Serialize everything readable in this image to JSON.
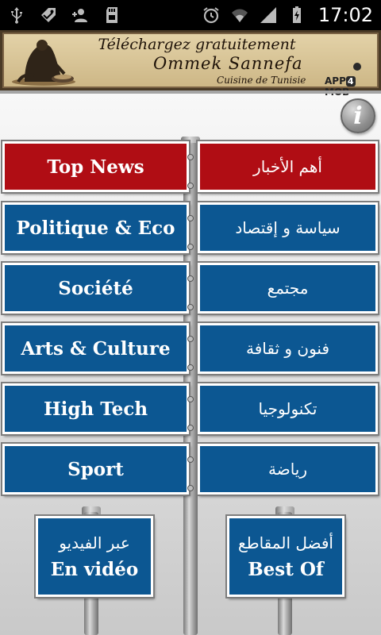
{
  "status_bar": {
    "time": "17:02",
    "left_icons": [
      "usb-icon",
      "tag-icon",
      "add-contact-icon",
      "sd-card-icon"
    ],
    "right_icons": [
      "alarm-icon",
      "wifi-icon",
      "signal-icon",
      "battery-charging-icon"
    ]
  },
  "banner": {
    "line1": "Téléchargez gratuitement",
    "line2": "Ommek Sannefa",
    "line3": "Cuisine de Tunisie",
    "brand_pre": "APP",
    "brand_four": "4",
    "brand_post": "MOB"
  },
  "info_button": {
    "icon": "info-icon",
    "glyph": "i"
  },
  "colors": {
    "blue_sign": "#0c5792",
    "red_sign": "#b00d14",
    "sign_border": "#ffffff"
  },
  "menu": {
    "rows": [
      {
        "fr": "Top News",
        "ar": "أهم الأخبار",
        "color": "red"
      },
      {
        "fr": "Politique & Eco",
        "ar": "سياسة و إقتصاد",
        "color": "blue"
      },
      {
        "fr": "Société",
        "ar": "مجتمع",
        "color": "blue"
      },
      {
        "fr": "Arts & Culture",
        "ar": "فنون و ثقافة",
        "color": "blue"
      },
      {
        "fr": "High Tech",
        "ar": "تكنولوجيا",
        "color": "blue"
      },
      {
        "fr": "Sport",
        "ar": "رياضة",
        "color": "blue"
      }
    ],
    "video": {
      "ar": "عبر الفيديو",
      "fr": "En vidéo"
    },
    "best_of": {
      "ar": "أفضل المقاطع",
      "fr": "Best Of"
    }
  }
}
